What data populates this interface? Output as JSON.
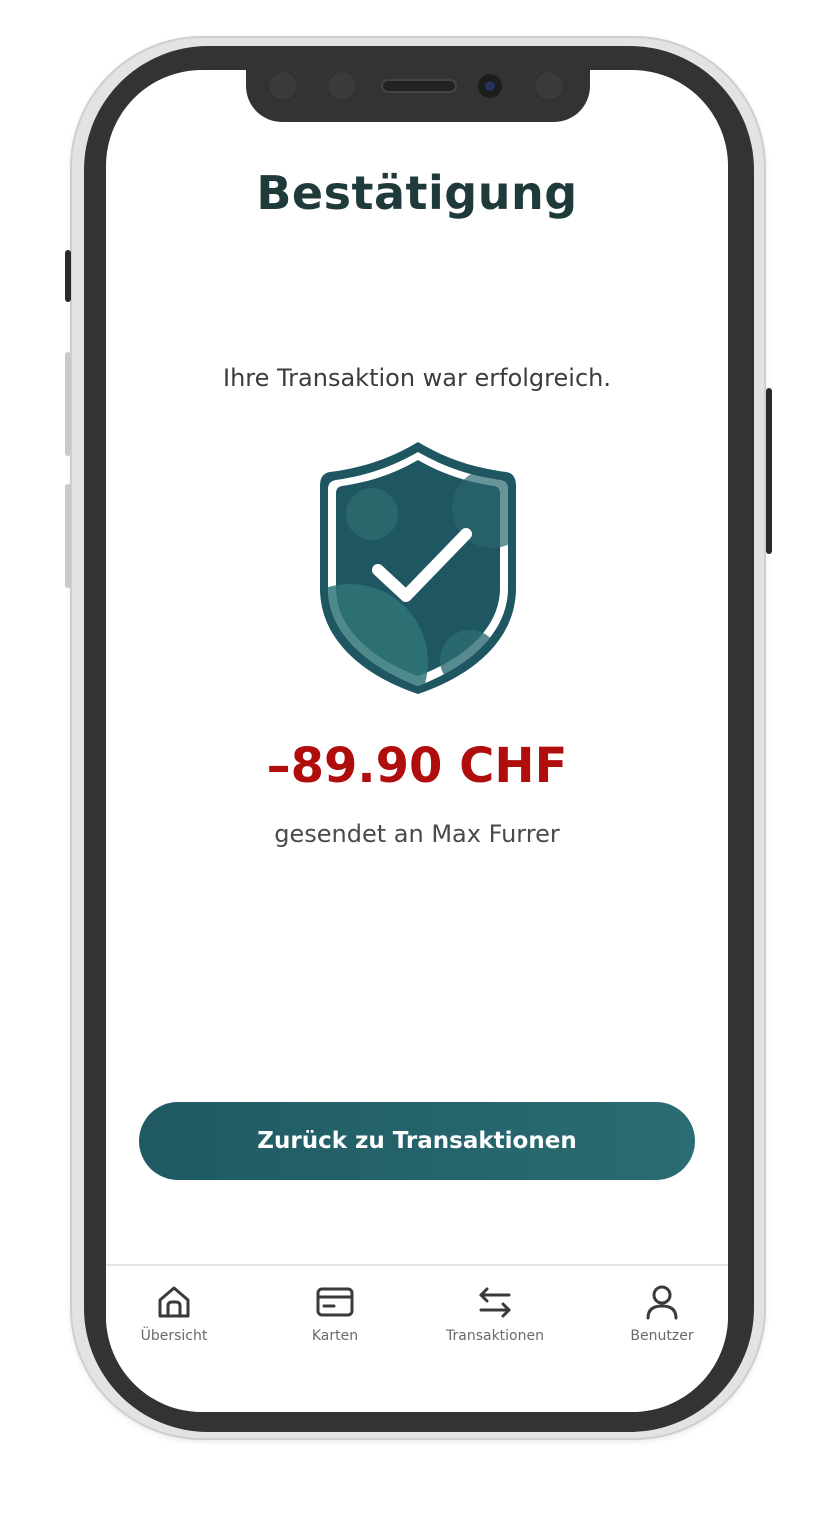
{
  "screen": {
    "title": "Bestätigung",
    "message": "Ihre Transaktion war erfolgreich.",
    "amount": "–89.90 CHF",
    "recipient": "gesendet an Max Furrer",
    "illustration_icon": "shield-check-icon"
  },
  "actions": {
    "back_button_label": "Zurück zu Transaktionen"
  },
  "bottom_nav": {
    "items": [
      {
        "label": "Übersicht",
        "icon": "home-icon"
      },
      {
        "label": "Karten",
        "icon": "card-icon"
      },
      {
        "label": "Transaktionen",
        "icon": "transfer-arrows-icon"
      },
      {
        "label": "Benutzer",
        "icon": "user-icon"
      }
    ]
  },
  "colors": {
    "primary": "#1f5a63",
    "amount_negative": "#b00d0d",
    "title": "#1f3a3a"
  }
}
